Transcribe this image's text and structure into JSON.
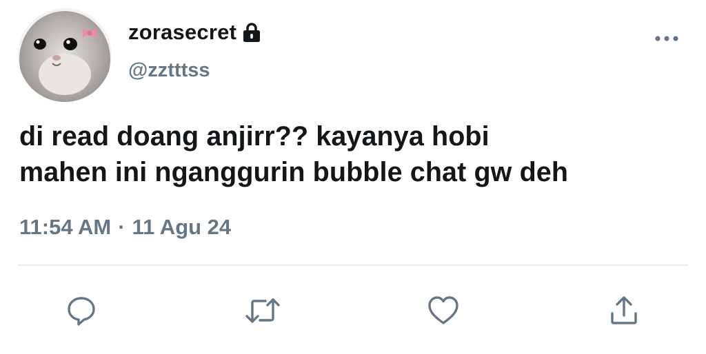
{
  "tweet": {
    "author": {
      "display_name": "zorasecret",
      "handle": "@zztttss",
      "avatar_icon": "hamster-avatar-icon",
      "protected_icon": "lock-icon"
    },
    "text_line_1": "di read doang anjirr?? kayanya hobi",
    "text_line_2": "mahen ini nganggurin bubble chat gw deh",
    "time": "11:54 AM",
    "separator": "·",
    "date": "11 Agu 24"
  },
  "actions": [
    {
      "icon": "reply-icon"
    },
    {
      "icon": "retweet-icon"
    },
    {
      "icon": "like-icon"
    },
    {
      "icon": "share-icon"
    }
  ],
  "colors": {
    "text": "#14171a",
    "secondary": "#657786",
    "divider": "#e6ecf0",
    "background": "#ffffff"
  }
}
